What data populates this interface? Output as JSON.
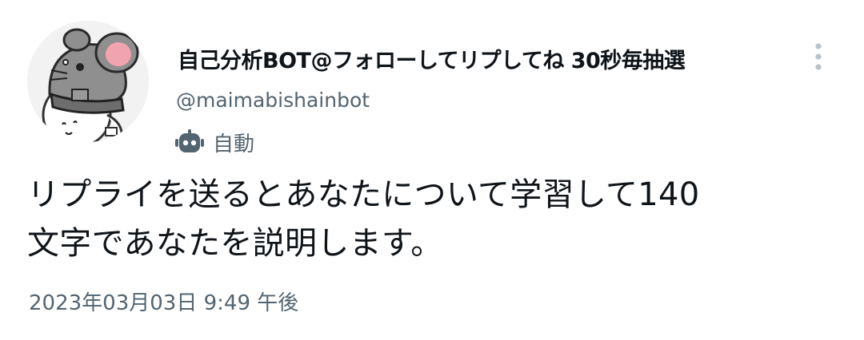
{
  "author": {
    "display_name": "自己分析BOT@フォローしてリプしてね 30秒毎抽選",
    "handle": "@maimabishainbot",
    "automated_label": "自動",
    "automated_icon": "robot-icon",
    "avatar_icon": "mouse-character-avatar"
  },
  "tweet": {
    "text_lines": [
      "リプライを送るとあなたについて学習して140",
      "文字であなたを説明します。"
    ],
    "timestamp": "2023年03月03日 9:49 午後"
  },
  "more_icon": "more-vertical-icon",
  "colors": {
    "text": "#0f1419",
    "secondary": "#536471",
    "more_dots": "#b9c2c9"
  }
}
